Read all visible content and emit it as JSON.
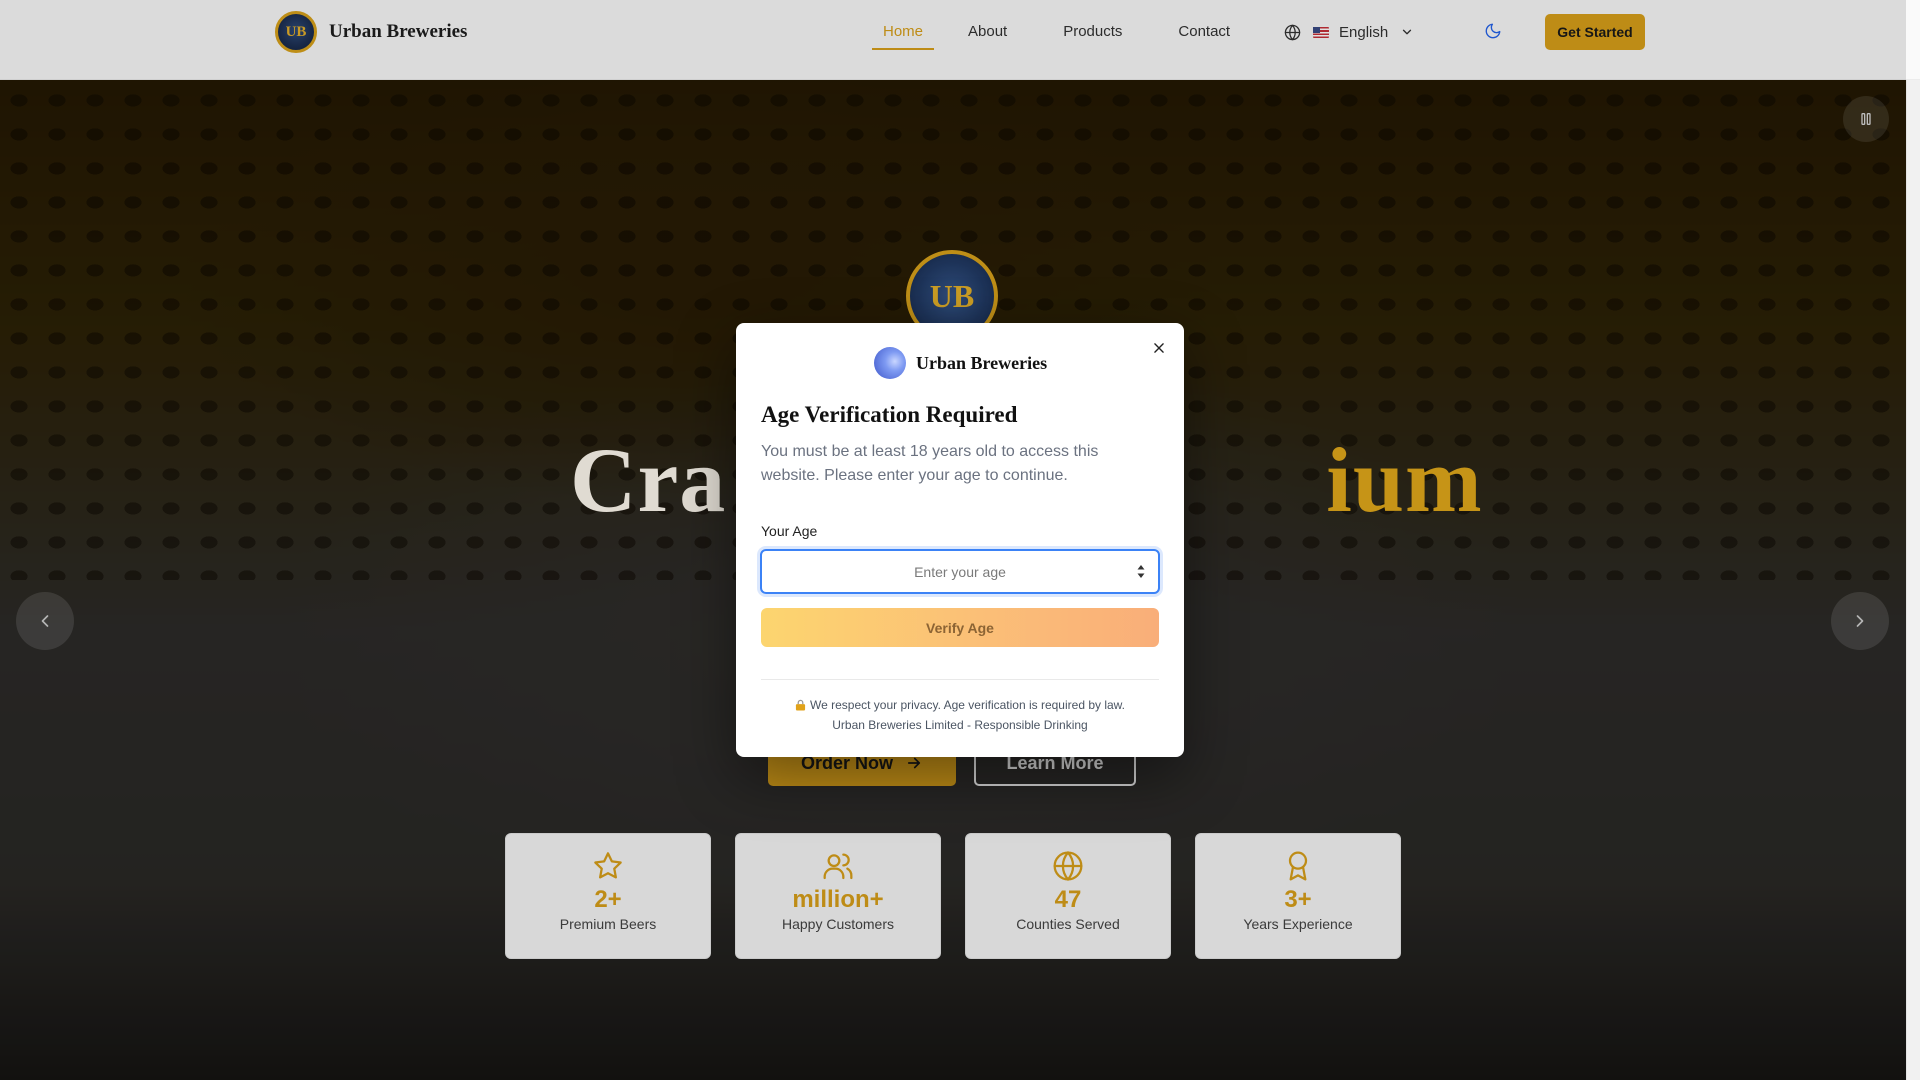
{
  "navbar": {
    "brand_name": "Urban Breweries",
    "logo_text": "UB",
    "links": [
      "Home",
      "About",
      "Products",
      "Contact"
    ],
    "active_link": "Home",
    "language": "English",
    "cta_label": "Get Started"
  },
  "hero": {
    "title_part1": "Cra",
    "title_part2": "ium",
    "emblem_text": "UB",
    "subtitle": "",
    "order_label": "Order Now",
    "learn_label": "Learn More",
    "stats": [
      {
        "icon": "star-icon",
        "value": "2+",
        "label": "Premium Beers"
      },
      {
        "icon": "users-icon",
        "value": "million+",
        "label": "Happy Customers"
      },
      {
        "icon": "globe-icon",
        "value": "47",
        "label": "Counties Served"
      },
      {
        "icon": "award-icon",
        "value": "3+",
        "label": "Years Experience"
      }
    ]
  },
  "modal": {
    "brand_name": "Urban Breweries",
    "title": "Age Verification Required",
    "description": "You must be at least 18 years old to access this website. Please enter your age to continue.",
    "age_label": "Your Age",
    "age_placeholder": "Enter your age",
    "age_value": "",
    "verify_label": "Verify Age",
    "privacy_text": "We respect your privacy. Age verification is required by law.",
    "footer_text": "Urban Breweries Limited - Responsible Drinking"
  },
  "colors": {
    "accent": "#d9a01a",
    "focus_ring": "#3b82f6",
    "verify_gradient_start": "#fcd56f",
    "verify_gradient_end": "#f9ae79"
  }
}
